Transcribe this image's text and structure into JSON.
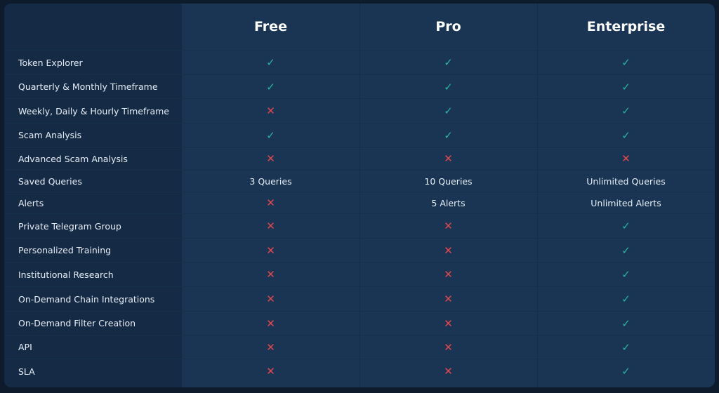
{
  "plans": [
    "Free",
    "Pro",
    "Enterprise"
  ],
  "colors": {
    "check": "#2bb3a0",
    "cross": "#e5474f",
    "background": "#0d1b2c",
    "card": "#1a3553",
    "label_column": "#152a45"
  },
  "icons": {
    "yes": "check-icon",
    "no": "cross-icon"
  },
  "rows": [
    {
      "feature": "Token Explorer",
      "h": 35,
      "values": [
        true,
        true,
        true
      ]
    },
    {
      "feature": "Quarterly & Monthly Timeframe",
      "h": 34,
      "values": [
        true,
        true,
        true
      ]
    },
    {
      "feature": "Weekly, Daily & Hourly Timeframe",
      "h": 35,
      "values": [
        false,
        true,
        true
      ]
    },
    {
      "feature": "Scam Analysis",
      "h": 34,
      "values": [
        true,
        true,
        true
      ]
    },
    {
      "feature": "Advanced Scam Analysis",
      "h": 33,
      "values": [
        false,
        false,
        false
      ]
    },
    {
      "feature": "Saved Queries",
      "h": 31,
      "values": [
        "3 Queries",
        "10 Queries",
        "Unlimited Queries"
      ]
    },
    {
      "feature": "Alerts",
      "h": 31,
      "values": [
        false,
        "5 Alerts",
        "Unlimited Alerts"
      ]
    },
    {
      "feature": "Private Telegram Group",
      "h": 35,
      "values": [
        false,
        false,
        true
      ]
    },
    {
      "feature": "Personalized Training",
      "h": 34,
      "values": [
        false,
        false,
        true
      ]
    },
    {
      "feature": "Institutional Research",
      "h": 35,
      "values": [
        false,
        false,
        true
      ]
    },
    {
      "feature": "On-Demand Chain Integrations",
      "h": 35,
      "values": [
        false,
        false,
        true
      ]
    },
    {
      "feature": "On-Demand Filter Creation",
      "h": 34,
      "values": [
        false,
        false,
        true
      ]
    },
    {
      "feature": "API",
      "h": 34,
      "values": [
        false,
        false,
        true
      ]
    },
    {
      "feature": "SLA",
      "h": 35,
      "values": [
        false,
        false,
        true
      ]
    }
  ]
}
